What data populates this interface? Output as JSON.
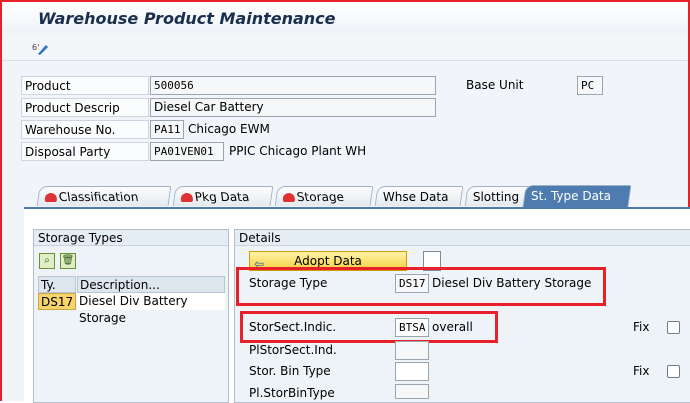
{
  "window": {
    "title": "Warehouse Product Maintenance"
  },
  "toolbar": {
    "display_change_icon": "display-change-icon"
  },
  "header": {
    "product_label": "Product",
    "product_value": "500056",
    "base_unit_label": "Base Unit",
    "base_unit_value": "PC",
    "descr_label": "Product Descrip",
    "descr_value": "Diesel Car Battery",
    "warehouse_label": "Warehouse No.",
    "warehouse_value": "PA11",
    "warehouse_text": "Chicago EWM",
    "disposal_label": "Disposal Party",
    "disposal_value": "PA01VEN01",
    "disposal_text": "PPIC Chicago Plant WH"
  },
  "tabs": [
    {
      "label": "Classification"
    },
    {
      "label": "Pkg Data"
    },
    {
      "label": "Storage"
    },
    {
      "label": "Whse Data"
    },
    {
      "label": "Slotting"
    },
    {
      "label": "St. Type Data"
    }
  ],
  "storage_types": {
    "title": "Storage Types",
    "col_type": "Ty.",
    "col_desc": "Description...",
    "rows": [
      {
        "type": "DS17",
        "desc": "Diesel Div Battery Storage"
      }
    ]
  },
  "details": {
    "title": "Details",
    "adopt_label": "Adopt Data",
    "storage_type_label": "Storage Type",
    "storage_type_value": "DS17",
    "storage_type_text": "Diesel Div Battery Storage",
    "storsect_label": "StorSect.Indic.",
    "storsect_value": "BTSA",
    "storsect_text": "overall",
    "fix_label_1": "Fix",
    "plstorsect_label": "PlStorSect.Ind.",
    "bin_type_label": "Stor. Bin Type",
    "fix_label_2": "Fix",
    "pl_bin_type_label": "Pl.StorBinType"
  },
  "colors": {
    "highlight": "#e8202a",
    "active_tab": "#4f7cb0"
  }
}
